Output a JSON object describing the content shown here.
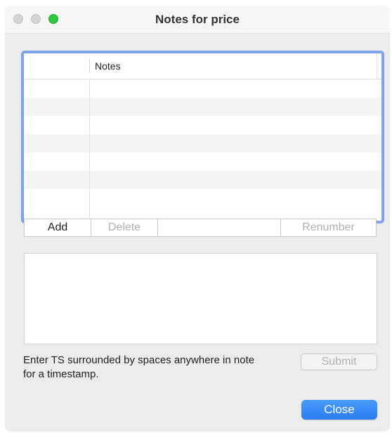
{
  "window": {
    "title": "Notes for price"
  },
  "table": {
    "columns": [
      "",
      "Notes"
    ],
    "rows": [
      {
        "index": "",
        "note": ""
      },
      {
        "index": "",
        "note": ""
      },
      {
        "index": "",
        "note": ""
      },
      {
        "index": "",
        "note": ""
      },
      {
        "index": "",
        "note": ""
      },
      {
        "index": "",
        "note": ""
      },
      {
        "index": "",
        "note": ""
      }
    ]
  },
  "buttons": {
    "add": "Add",
    "delete": "Delete",
    "renumber": "Renumber",
    "submit": "Submit",
    "close": "Close"
  },
  "note_input": {
    "value": ""
  },
  "hint": "Enter TS surrounded by spaces anywhere in note for a timestamp.",
  "colors": {
    "focus_ring": "#7fa3ea",
    "primary_button": "#2a7cf2",
    "zoom_button": "#2bc840"
  }
}
